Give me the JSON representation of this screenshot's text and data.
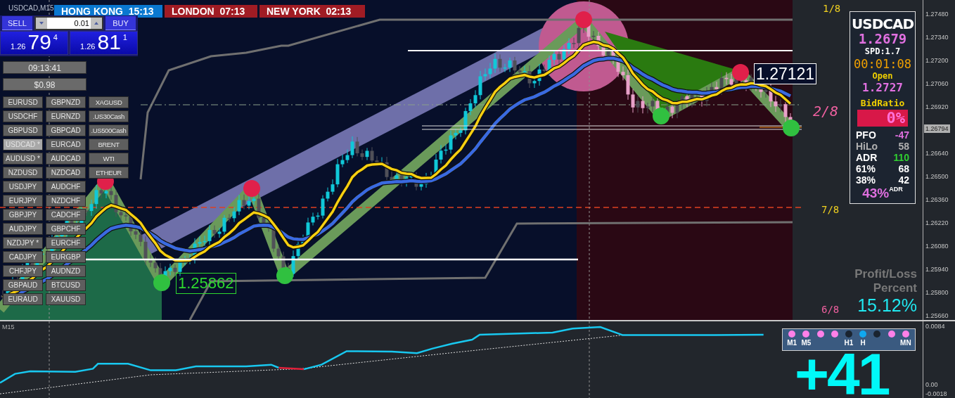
{
  "chart_title": "USDCAD,M15",
  "sessions": [
    {
      "city": "HONG KONG",
      "time": "15:13",
      "color": "#0a78d0"
    },
    {
      "city": "LONDON",
      "time": "07:13",
      "color": "#a01c24"
    },
    {
      "city": "NEW YORK",
      "time": "02:13",
      "color": "#a01c24"
    }
  ],
  "trade_panel": {
    "sell_label": "SELL",
    "buy_label": "BUY",
    "lot": "0.01",
    "sell_price": {
      "prefix": "1.26",
      "big": "79",
      "sup": "4"
    },
    "buy_price": {
      "prefix": "1.26",
      "big": "81",
      "sup": "1"
    }
  },
  "clock": "09:13:41",
  "profit_button": "$0.98",
  "symbol_columns": [
    [
      {
        "label": "EURUSD",
        "selected": false
      },
      {
        "label": "USDCHF",
        "selected": false
      },
      {
        "label": "GBPUSD",
        "selected": false
      },
      {
        "label": "USDCAD *",
        "selected": true
      },
      {
        "label": "AUDUSD *",
        "selected": false
      },
      {
        "label": "NZDUSD",
        "selected": false
      },
      {
        "label": "USDJPY",
        "selected": false
      },
      {
        "label": "EURJPY",
        "selected": false
      },
      {
        "label": "GBPJPY",
        "selected": false
      },
      {
        "label": "AUDJPY",
        "selected": false
      },
      {
        "label": "NZDJPY *",
        "selected": false
      },
      {
        "label": "CADJPY",
        "selected": false
      },
      {
        "label": "CHFJPY",
        "selected": false
      },
      {
        "label": "GBPAUD",
        "selected": false
      },
      {
        "label": "EURAUD",
        "selected": false
      }
    ],
    [
      {
        "label": "GBPNZD",
        "selected": false
      },
      {
        "label": "EURNZD",
        "selected": false
      },
      {
        "label": "GBPCAD",
        "selected": false
      },
      {
        "label": "EURCAD",
        "selected": false
      },
      {
        "label": "AUDCAD",
        "selected": false
      },
      {
        "label": "NZDCAD",
        "selected": false
      },
      {
        "label": "AUDCHF",
        "selected": false
      },
      {
        "label": "NZDCHF",
        "selected": false
      },
      {
        "label": "CADCHF",
        "selected": false
      },
      {
        "label": "GBPCHF",
        "selected": false
      },
      {
        "label": "EURCHF",
        "selected": false
      },
      {
        "label": "EURGBP",
        "selected": false
      },
      {
        "label": "AUDNZD",
        "selected": false
      },
      {
        "label": "BTCUSD",
        "selected": false
      },
      {
        "label": "XAUUSD",
        "selected": false
      }
    ],
    [
      {
        "label": "XAGUSD",
        "selected": false
      },
      {
        "label": ".US30Cash",
        "selected": false
      },
      {
        "label": ".US500Cash",
        "selected": false
      },
      {
        "label": "BRENT",
        "selected": false
      },
      {
        "label": "WTI",
        "selected": false
      },
      {
        "label": "ETHEUR",
        "selected": false
      }
    ]
  ],
  "chart_labels": [
    {
      "kind": "low",
      "text": "1.25862"
    },
    {
      "kind": "high",
      "text": "1.27121"
    }
  ],
  "murrey_labels": [
    {
      "text": "1/8",
      "color": "#f0d020"
    },
    {
      "text": "2/8",
      "color": "#f060a0"
    },
    {
      "text": "7/8",
      "color": "#f0d020"
    },
    {
      "text": "6/8",
      "color": "#f060a0"
    }
  ],
  "info_panel": {
    "symbol": "USDCAD",
    "price": "1.2679",
    "spread": "SPD:1.7",
    "timer": "00:01:08",
    "open_label": "Open",
    "open_price": "1.2727",
    "bid_ratio_label": "BidRatio",
    "bid_ratio": "0%",
    "stats": [
      {
        "label": "PFO",
        "value": "-47",
        "color": "#e070e0",
        "muted": false
      },
      {
        "label": "HiLo",
        "value": "58",
        "color": "#b0b0b0",
        "muted": true
      },
      {
        "label": "ADR",
        "value": "110",
        "color": "#30d030",
        "muted": false
      },
      {
        "label": "61%",
        "value": "68",
        "color": "#ffffff",
        "muted": false
      },
      {
        "label": "38%",
        "value": "42",
        "color": "#ffffff",
        "muted": false
      }
    ],
    "adr_percent": "43%",
    "adr_label": "ADR"
  },
  "profit_loss": {
    "title": "Profit/Loss",
    "subtitle": "Percent",
    "value": "15.12%"
  },
  "price_axis": {
    "ticks": [
      "1.27480",
      "1.27340",
      "1.27200",
      "1.27060",
      "1.26920",
      "1.26640",
      "1.26500",
      "1.26360",
      "1.26220",
      "1.26080",
      "1.25940",
      "1.25800",
      "1.25660"
    ],
    "current": "1.26794"
  },
  "indicator": {
    "label": "M15",
    "axis": [
      "0.0084",
      "0.00",
      "-0.0018"
    ]
  },
  "timeframes": [
    {
      "label": "M1",
      "color": "#ff80e8"
    },
    {
      "label": "M5",
      "color": "#ff80e8"
    },
    {
      "color": "#ff80e8"
    },
    {
      "color": "#ff80e8"
    },
    {
      "label": "H1",
      "color": "#1a2430"
    },
    {
      "label": "H",
      "color": "#10a8f0"
    },
    {
      "color": "#1a2430"
    },
    {
      "color": "#ff80e8"
    },
    {
      "label": "MN",
      "color": "#ff80e8"
    }
  ],
  "big_counter": "+41"
}
